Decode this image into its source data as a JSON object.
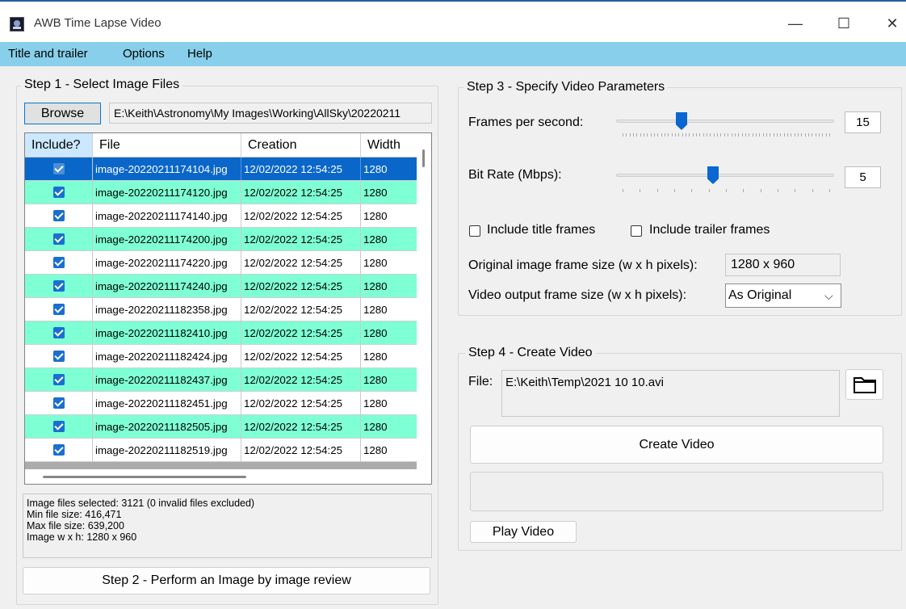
{
  "window": {
    "title": "AWB Time Lapse Video",
    "minimize": "—",
    "maximize": "☐",
    "close": "✕"
  },
  "menu": [
    "Title and trailer",
    "Options",
    "Help"
  ],
  "step1": {
    "title": "Step 1 - Select Image Files",
    "browse_label": "Browse",
    "path": "E:\\Keith\\Astronomy\\My Images\\Working\\AllSky\\20220211",
    "columns": [
      "Include?",
      "File",
      "Creation",
      "Width"
    ],
    "rows": [
      {
        "file": "image-20220211174104.jpg",
        "created": "12/02/2022 12:54:25",
        "width": "1280"
      },
      {
        "file": "image-20220211174120.jpg",
        "created": "12/02/2022 12:54:25",
        "width": "1280"
      },
      {
        "file": "image-20220211174140.jpg",
        "created": "12/02/2022 12:54:25",
        "width": "1280"
      },
      {
        "file": "image-20220211174200.jpg",
        "created": "12/02/2022 12:54:25",
        "width": "1280"
      },
      {
        "file": "image-20220211174220.jpg",
        "created": "12/02/2022 12:54:25",
        "width": "1280"
      },
      {
        "file": "image-20220211174240.jpg",
        "created": "12/02/2022 12:54:25",
        "width": "1280"
      },
      {
        "file": "image-20220211182358.jpg",
        "created": "12/02/2022 12:54:25",
        "width": "1280"
      },
      {
        "file": "image-20220211182410.jpg",
        "created": "12/02/2022 12:54:25",
        "width": "1280"
      },
      {
        "file": "image-20220211182424.jpg",
        "created": "12/02/2022 12:54:25",
        "width": "1280"
      },
      {
        "file": "image-20220211182437.jpg",
        "created": "12/02/2022 12:54:25",
        "width": "1280"
      },
      {
        "file": "image-20220211182451.jpg",
        "created": "12/02/2022 12:54:25",
        "width": "1280"
      },
      {
        "file": "image-20220211182505.jpg",
        "created": "12/02/2022 12:54:25",
        "width": "1280"
      },
      {
        "file": "image-20220211182519.jpg",
        "created": "12/02/2022 12:54:25",
        "width": "1280"
      }
    ],
    "colors": {
      "selected": "#0a67c9",
      "alt": "#7fffd4",
      "normal": "#ffffff"
    },
    "summary": [
      "Image files selected: 3121  (0 invalid files excluded)",
      "Min file size: 416,471",
      "Max file size: 639,200",
      "Image w x h: 1280 x 960"
    ]
  },
  "step2": {
    "label": "Step 2 - Perform an Image by image review"
  },
  "step3": {
    "title": "Step 3 - Specify Video Parameters",
    "fps_label": "Frames per second:",
    "fps_value": "15",
    "fps_fraction": 0.29,
    "bitrate_label": "Bit Rate (Mbps):",
    "bitrate_value": "5",
    "bitrate_fraction": 0.44,
    "include_title": "Include title frames",
    "include_trailer": "Include trailer frames",
    "orig_size_label": "Original image frame size (w x h pixels):",
    "orig_size_value": "1280 x 960",
    "output_size_label": "Video output frame size (w x h pixels):",
    "output_size_value": "As Original"
  },
  "step4": {
    "title": "Step 4 - Create Video",
    "file_label": "File:",
    "file_value": "E:\\Keith\\Temp\\2021 10 10.avi",
    "create_label": "Create Video",
    "play_label": "Play Video"
  }
}
